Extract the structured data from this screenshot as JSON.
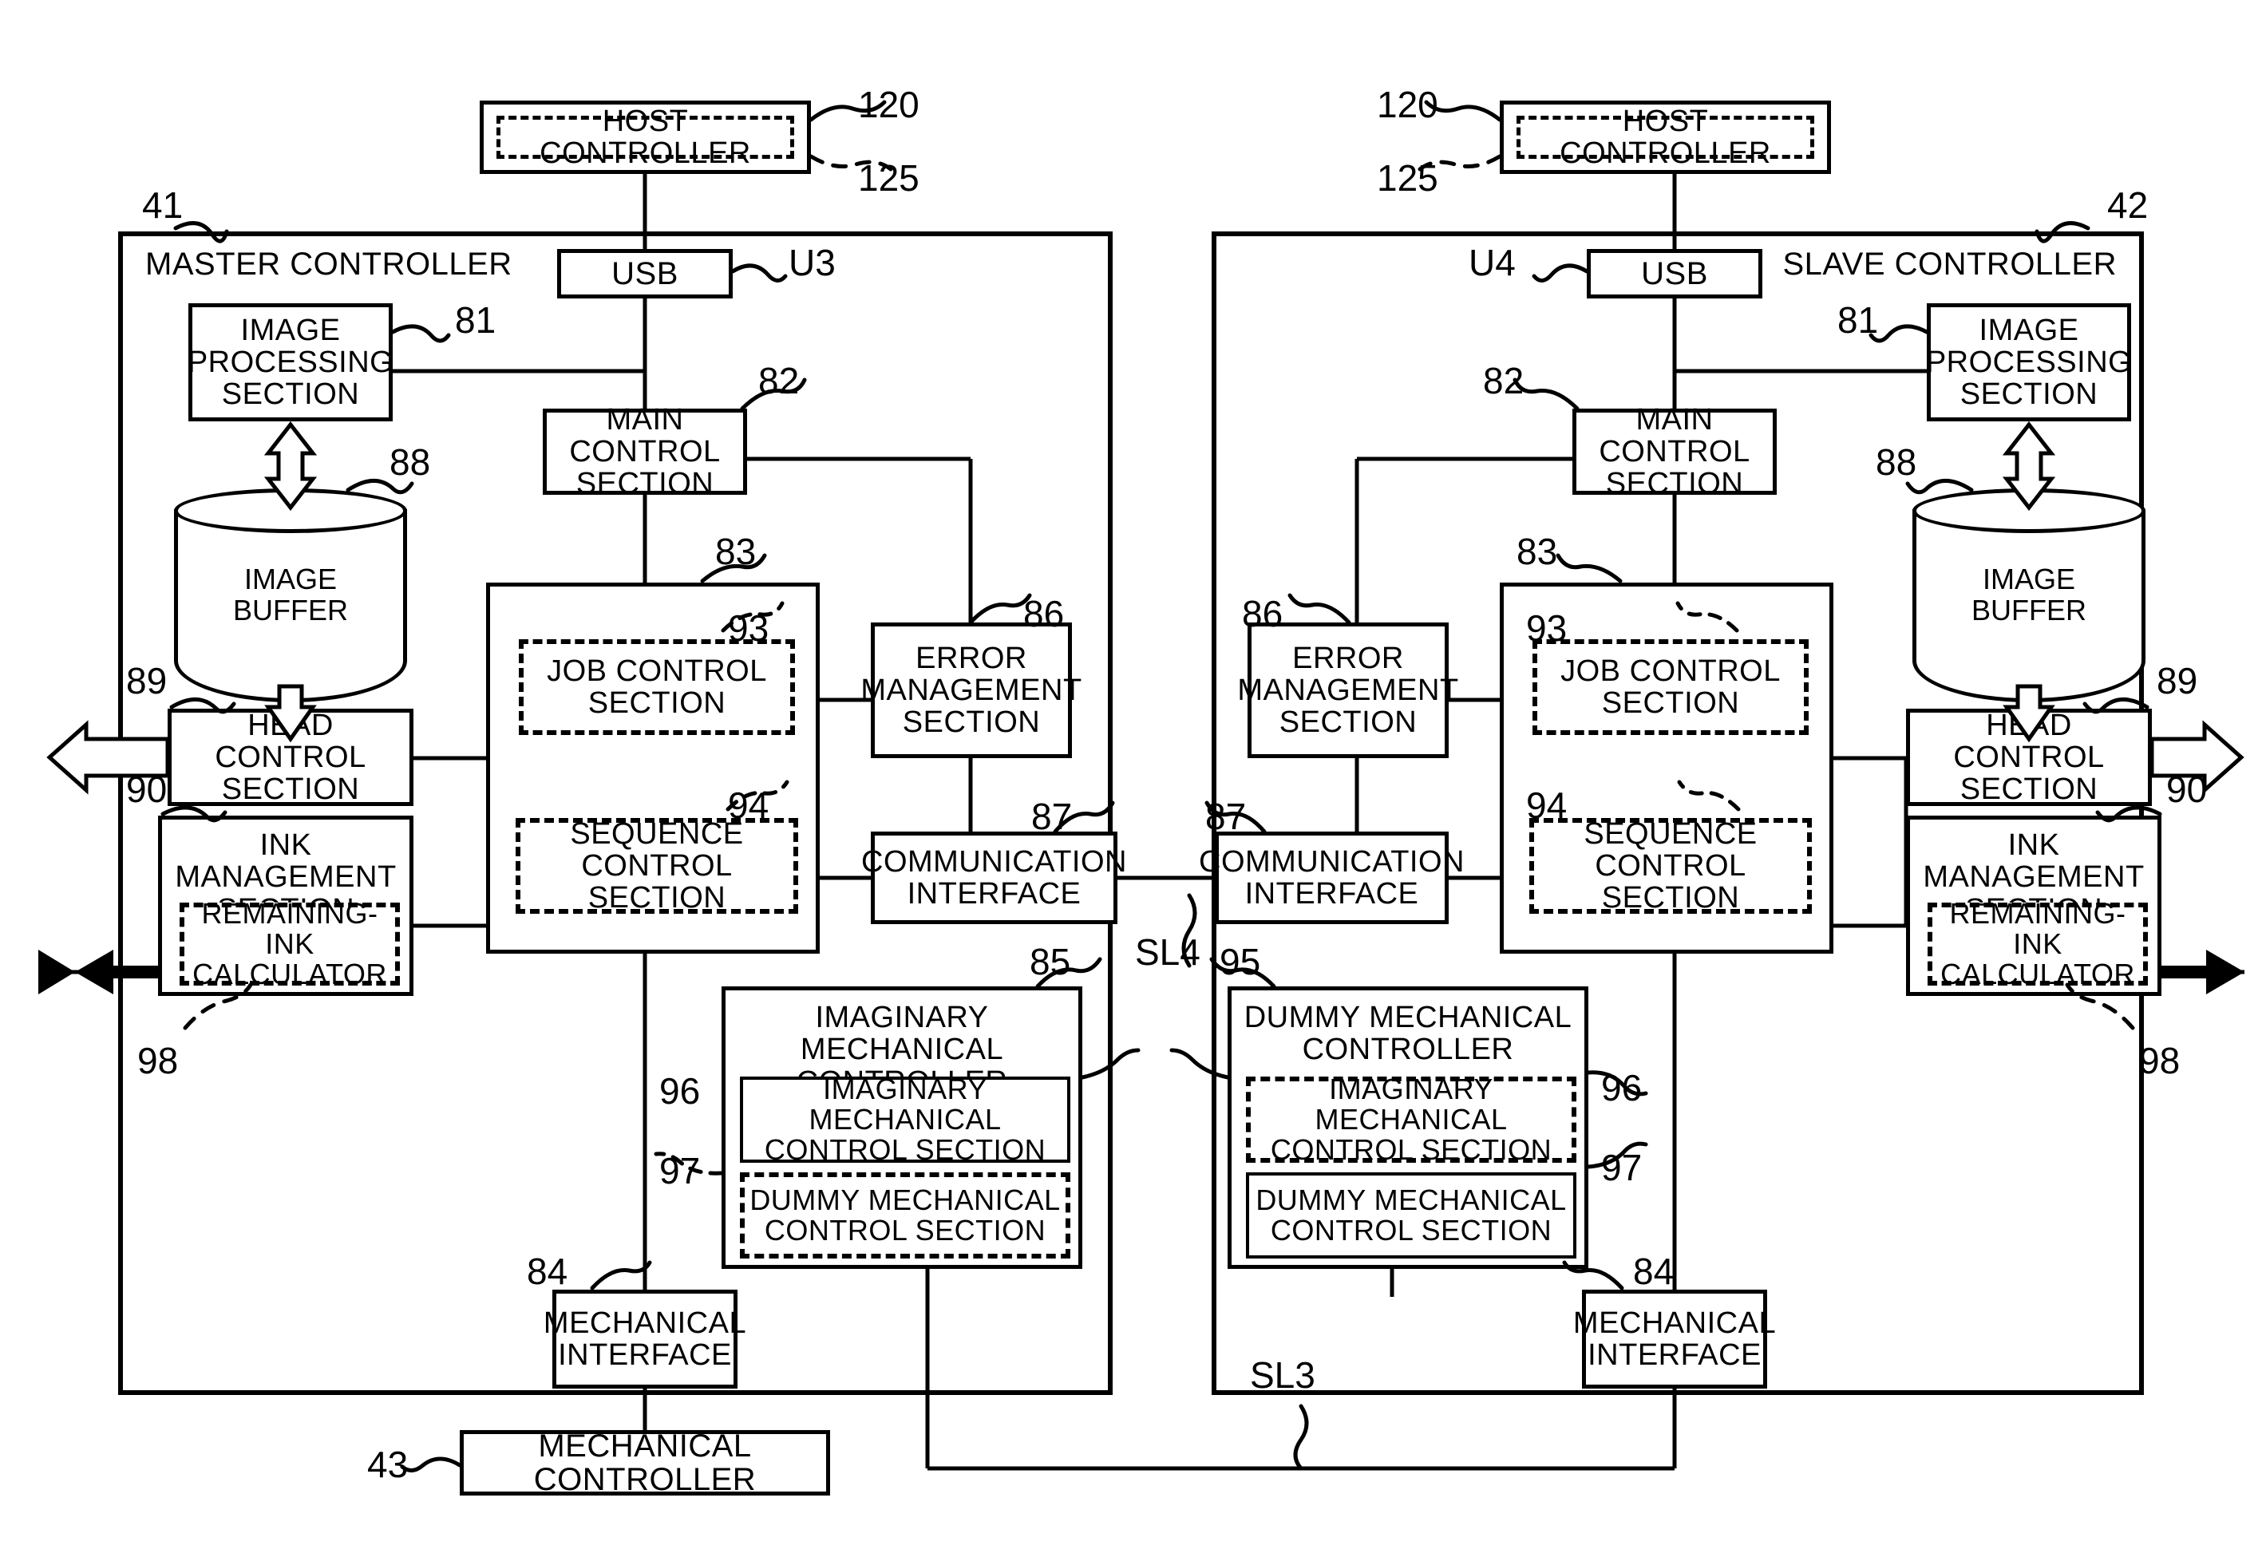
{
  "figure": {
    "type": "patent-block-diagram",
    "background": "#ffffff",
    "line_color": "#000000"
  },
  "left": {
    "outer_label": "MASTER CONTROLLER",
    "outer_ref": "41",
    "host": {
      "label": "HOST CONTROLLER",
      "ref_outer": "120",
      "ref_inner": "125"
    },
    "usb": {
      "label": "USB",
      "ref": "U3"
    },
    "image_processing": {
      "label": "IMAGE\nPROCESSING\nSECTION",
      "ref": "81"
    },
    "image_buffer": {
      "label": "IMAGE\nBUFFER",
      "ref": "88"
    },
    "main_control": {
      "label": "MAIN CONTROL\nSECTION",
      "ref": "82"
    },
    "control_block": {
      "ref": "83"
    },
    "job_control": {
      "label": "JOB CONTROL\nSECTION",
      "ref": "93"
    },
    "sequence_control": {
      "label": "SEQUENCE\nCONTROL SECTION",
      "ref": "94"
    },
    "error_management": {
      "label": "ERROR\nMANAGEMENT\nSECTION",
      "ref": "86"
    },
    "communication_interface": {
      "label": "COMMUNICATION\nINTERFACE",
      "ref": "87"
    },
    "head_control": {
      "label": "HEAD CONTROL\nSECTION",
      "ref": "89"
    },
    "ink_management": {
      "label": "INK MANAGEMENT\nSECTION",
      "ref": "90"
    },
    "remaining_ink": {
      "label": "REMAINING-INK\nCALCULATOR",
      "ref": "98"
    },
    "mech_controller_box": {
      "label": "IMAGINARY MECHANICAL\nCONTROLLER",
      "ref": "85"
    },
    "imaginary_mech_section": {
      "label": "IMAGINARY MECHANICAL\nCONTROL SECTION",
      "ref": "96"
    },
    "dummy_mech_section": {
      "label": "DUMMY MECHANICAL\nCONTROL SECTION",
      "ref": "97"
    },
    "mechanical_interface": {
      "label": "MECHANICAL\nINTERFACE",
      "ref": "84"
    },
    "mechanical_controller": {
      "label": "MECHANICAL CONTROLLER",
      "ref": "43"
    }
  },
  "right": {
    "outer_label": "SLAVE CONTROLLER",
    "outer_ref": "42",
    "host": {
      "label": "HOST CONTROLLER",
      "ref_outer": "120",
      "ref_inner": "125"
    },
    "usb": {
      "label": "USB",
      "ref": "U4"
    },
    "image_processing": {
      "label": "IMAGE\nPROCESSING\nSECTION",
      "ref": "81"
    },
    "image_buffer": {
      "label": "IMAGE\nBUFFER",
      "ref": "88"
    },
    "main_control": {
      "label": "MAIN CONTROL\nSECTION",
      "ref": "82"
    },
    "control_block": {
      "ref": "83"
    },
    "job_control": {
      "label": "JOB CONTROL\nSECTION",
      "ref": "93"
    },
    "sequence_control": {
      "label": "SEQUENCE\nCONTROL SECTION",
      "ref": "94"
    },
    "error_management": {
      "label": "ERROR\nMANAGEMENT\nSECTION",
      "ref": "86"
    },
    "communication_interface": {
      "label": "COMMUNICATION\nINTERFACE",
      "ref": "87"
    },
    "head_control": {
      "label": "HEAD CONTROL\nSECTION",
      "ref": "89"
    },
    "ink_management": {
      "label": "INK MANAGEMENT\nSECTION",
      "ref": "90"
    },
    "remaining_ink": {
      "label": "REMAINING-INK\nCALCULATOR",
      "ref": "98"
    },
    "mech_controller_box": {
      "label": "DUMMY MECHANICAL\nCONTROLLER",
      "ref": "95"
    },
    "imaginary_mech_section": {
      "label": "IMAGINARY MECHANICAL\nCONTROL SECTION",
      "ref": "96"
    },
    "dummy_mech_section": {
      "label": "DUMMY MECHANICAL\nCONTROL SECTION",
      "ref": "97"
    },
    "mechanical_interface": {
      "label": "MECHANICAL\nINTERFACE",
      "ref": "84"
    }
  },
  "links": {
    "comm_link": "SL4",
    "mech_link": "SL3"
  }
}
